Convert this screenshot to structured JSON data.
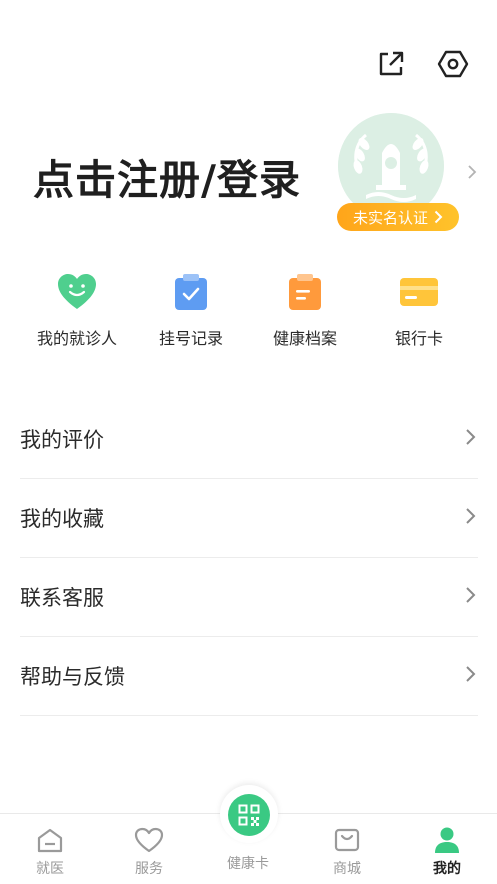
{
  "header": {
    "share_icon": "share-icon",
    "settings_icon": "settings-hexagon-icon"
  },
  "profile": {
    "login_prompt": "点击注册/登录",
    "verify_badge": "未实名认证"
  },
  "quick_actions": [
    {
      "label": "我的就诊人",
      "icon": "heart-smile-icon",
      "color": "#4fcf8e"
    },
    {
      "label": "挂号记录",
      "icon": "clipboard-check-icon",
      "color": "#5e9cf2"
    },
    {
      "label": "健康档案",
      "icon": "health-record-icon",
      "color": "#ff9a3c"
    },
    {
      "label": "银行卡",
      "icon": "bank-card-icon",
      "color": "#ffc53a"
    }
  ],
  "menu": [
    {
      "label": "我的评价"
    },
    {
      "label": "我的收藏"
    },
    {
      "label": "联系客服"
    },
    {
      "label": "帮助与反馈"
    }
  ],
  "tabbar": {
    "tabs": [
      {
        "label": "就医",
        "icon": "clinic-icon"
      },
      {
        "label": "服务",
        "icon": "heart-outline-icon"
      },
      {
        "label": "健康卡",
        "icon": "qr-code-icon"
      },
      {
        "label": "商城",
        "icon": "shopping-bag-icon"
      },
      {
        "label": "我的",
        "icon": "user-icon"
      }
    ],
    "active": "我的"
  },
  "colors": {
    "accent_green": "#3ac983",
    "badge_orange": "#ffa51a",
    "text_primary": "#222222",
    "text_secondary": "#9a9a9a"
  }
}
